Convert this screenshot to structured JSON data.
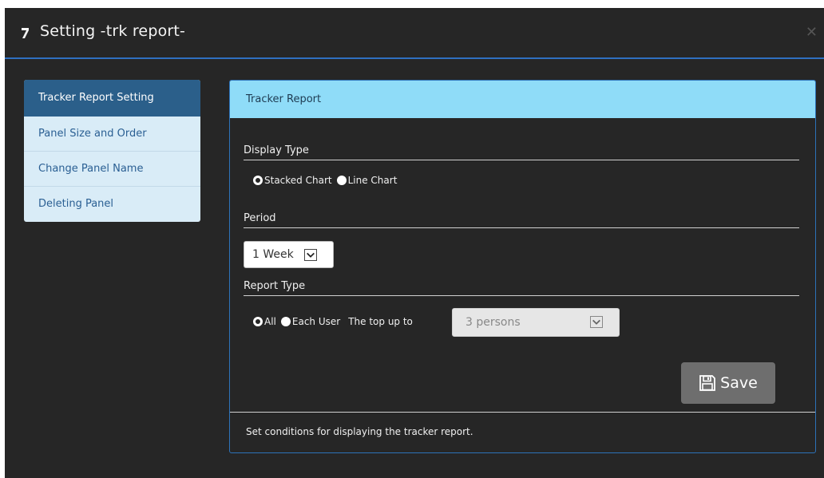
{
  "dialog": {
    "title": "Setting -trk report-"
  },
  "sidebar": {
    "items": [
      {
        "label": "Tracker Report Setting",
        "active": true
      },
      {
        "label": "Panel Size and Order",
        "active": false
      },
      {
        "label": "Change Panel Name",
        "active": false
      },
      {
        "label": "Deleting Panel",
        "active": false
      }
    ]
  },
  "panel": {
    "header": "Tracker Report",
    "display_type": {
      "title": "Display Type",
      "options": [
        {
          "label": "Stacked Chart",
          "checked": true
        },
        {
          "label": "Line Chart",
          "checked": false
        }
      ]
    },
    "period": {
      "title": "Period",
      "selected": "1 Week"
    },
    "report_type": {
      "title": "Report Type",
      "options": [
        {
          "label": "All",
          "checked": true
        },
        {
          "label": "Each User",
          "checked": false
        }
      ],
      "top_up_to_label": "The top up to",
      "top_up_to_selected": "3 persons"
    },
    "save_label": "Save",
    "footer": "Set conditions for displaying the tracker report."
  },
  "colors": {
    "background": "#262626",
    "accent_border": "#2f6fc0",
    "panel_header": "#8fdcf8",
    "sidebar_bg": "#d9ecf7",
    "sidebar_active": "#2b5f8a",
    "save_button": "#6e6e6e"
  },
  "icons": {
    "title": "wrench-icon",
    "close": "close-icon",
    "save": "floppy-disk-icon",
    "dropdown": "chevron-down-icon"
  }
}
